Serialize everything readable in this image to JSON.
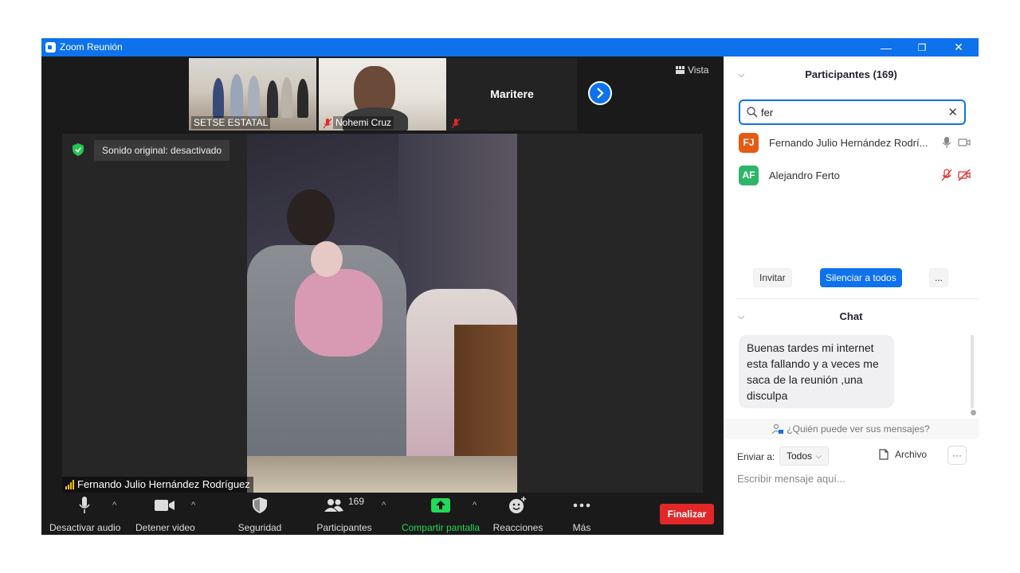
{
  "window": {
    "title": "Zoom Reunión",
    "minimize": "—",
    "restore": "❐",
    "close": "✕"
  },
  "gallery": {
    "tiles": [
      {
        "name": "SETSE ESTATAL"
      },
      {
        "name": "Nohemi Cruz"
      },
      {
        "name": "Maritere"
      }
    ],
    "view_label": "Vista"
  },
  "stage": {
    "sound_label": "Sonido original: desactivado",
    "speaker_name": "Fernando Julio Hernández Rodríguez"
  },
  "toolbar": {
    "mute": "Desactivar audio",
    "video": "Detener video",
    "security": "Seguridad",
    "participants": "Participantes",
    "participants_count": "169",
    "share": "Compartir pantalla",
    "reactions": "Reacciones",
    "more": "Más",
    "end": "Finalizar"
  },
  "panel": {
    "participants_title": "Participantes (169)",
    "search_value": "fer",
    "participants": [
      {
        "initials": "FJ",
        "name": "Fernando Julio Hernández Rodrí...",
        "color": "#e55b13"
      },
      {
        "initials": "AF",
        "name": "Alejandro Ferto",
        "color": "#2fb56a"
      }
    ],
    "invite": "Invitar",
    "mute_all": "Silenciar a todos",
    "more": "...",
    "chat_title": "Chat",
    "message": "Buenas tardes mi internet esta fallando y a veces me saca de la reunión ,una disculpa",
    "who_sees": "¿Quién puede ver sus mensajes?",
    "send_to_label": "Enviar a:",
    "send_to_value": "Todos",
    "file": "Archivo",
    "input_placeholder": "Escribir mensaje aquí..."
  },
  "colors": {
    "accent": "#0e72ed",
    "end": "#e02828",
    "share": "#23d959"
  }
}
